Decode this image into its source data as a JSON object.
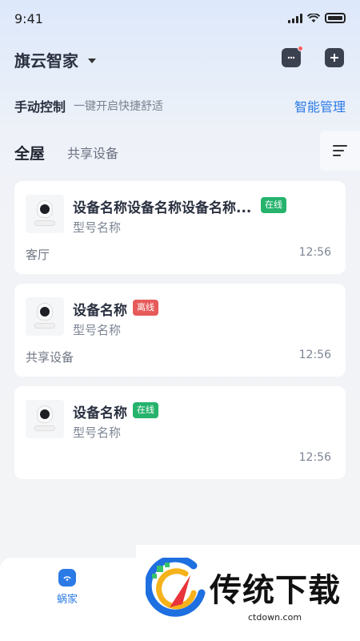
{
  "status_bar": {
    "time": "9:41"
  },
  "header": {
    "home_name": "旗云智家"
  },
  "manual": {
    "title": "手动控制",
    "subtitle": "一键开启快捷舒适",
    "smart_manage": "智能管理"
  },
  "tabs": [
    {
      "label": "全屋",
      "active": true
    },
    {
      "label": "共享设备",
      "active": false
    }
  ],
  "devices": [
    {
      "name": "设备名称设备名称设备名称...",
      "status": "在线",
      "model": "型号名称",
      "room": "客厅",
      "time": "12:56"
    },
    {
      "name": "设备名称",
      "status": "离线",
      "model": "型号名称",
      "room": "共享设备",
      "time": "12:56"
    },
    {
      "name": "设备名称",
      "status": "在线",
      "model": "型号名称",
      "room": "",
      "time": "12:56"
    }
  ],
  "bottom_nav": [
    {
      "label": "蜗家",
      "icon": "home-icon",
      "active": true
    }
  ],
  "watermark": {
    "text": "传统下载",
    "url": "ctdown.com"
  },
  "colors": {
    "accent": "#2b7ae6",
    "online": "#26b36c",
    "offline": "#e75a5a"
  }
}
